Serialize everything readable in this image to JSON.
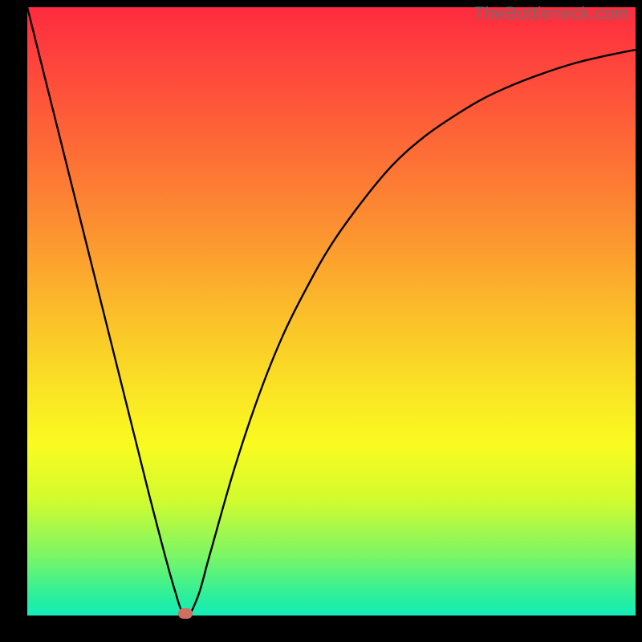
{
  "watermark": "TheBottleneck.com",
  "colors": {
    "background": "#000000",
    "curve": "#000000",
    "marker": "#cf6e62",
    "gradient_top": "#fe2b3f",
    "gradient_bottom": "#14edb7"
  },
  "chart_data": {
    "type": "line",
    "title": "",
    "xlabel": "",
    "ylabel": "",
    "xlim": [
      0,
      100
    ],
    "ylim": [
      0,
      100
    ],
    "grid": false,
    "series": [
      {
        "name": "bottleneck-curve",
        "x": [
          0,
          5,
          10,
          15,
          20,
          24,
          26,
          28,
          30,
          34,
          38,
          42,
          46,
          50,
          55,
          60,
          65,
          70,
          75,
          80,
          85,
          90,
          95,
          100
        ],
        "values": [
          100,
          80,
          60,
          40,
          20,
          5,
          0,
          3,
          10,
          24,
          36,
          46,
          54,
          61,
          68,
          74,
          78.5,
          82,
          85,
          87.3,
          89.2,
          90.8,
          92,
          93
        ]
      }
    ],
    "marker": {
      "x": 26,
      "y": 0
    },
    "annotations": []
  }
}
